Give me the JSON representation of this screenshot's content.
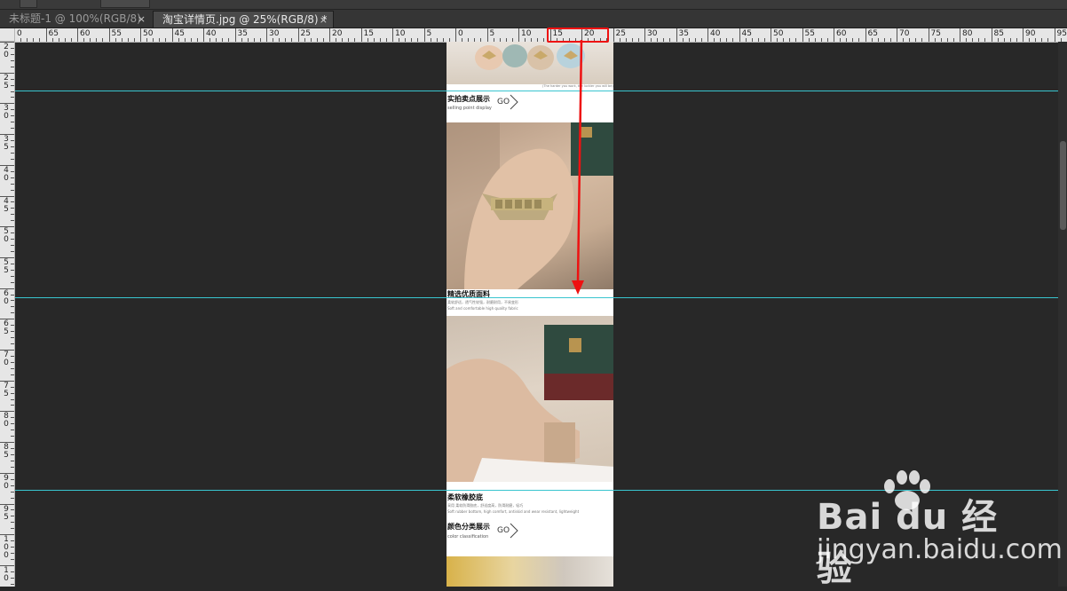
{
  "tabs": [
    {
      "label": "未标题-1 @ 100%(RGB/8)",
      "close": "×",
      "active": false
    },
    {
      "label": "淘宝详情页.jpg @ 25%(RGB/8) *",
      "close": "×",
      "active": true
    }
  ],
  "ruler": {
    "h_labels": [
      "0",
      "65",
      "60",
      "55",
      "50",
      "45",
      "40",
      "35",
      "30",
      "25",
      "20",
      "15",
      "10",
      "5",
      "0",
      "5",
      "10",
      "15",
      "20",
      "25",
      "30",
      "35",
      "40",
      "45",
      "50",
      "55",
      "60",
      "65",
      "70",
      "75",
      "80",
      "85",
      "90",
      "95"
    ],
    "v_labels": [
      "2\n0",
      "2\n5",
      "3\n0",
      "3\n5",
      "4\n0",
      "4\n5",
      "5\n0",
      "5\n5",
      "6\n0",
      "6\n5",
      "7\n0",
      "7\n5",
      "8\n0",
      "8\n5",
      "9\n0",
      "9\n5",
      "1\n0\n0",
      "1\n0"
    ]
  },
  "document": {
    "banner_tiny": "(The harder you work, the luckier you will be)",
    "section1_title": "实拍卖点展示",
    "section1_sub": "selling point display",
    "go": "GO",
    "section2_title": "精选优质面料",
    "section2_sub": "柔软舒适，透气性较强，耐磨耐用，不易变形",
    "section2_sub_en": "Soft and comfortable high quality fabric",
    "section3_title": "柔软橡胶底",
    "section3_sub": "采用 柔软防滑胶底，舒适度高，防滑耐磨，轻巧",
    "section3_sub_en": "Soft rubber bottom, high comfort, antiskid and wear resistant, lightweight",
    "section4_title": "颜色分类展示",
    "section4_sub": "color classification"
  },
  "watermark": {
    "logo": "Bai du 经验",
    "url": "jingyan.baidu.com"
  },
  "colors": {
    "guide": "#39c5cf",
    "highlight": "#ee1111",
    "canvas": "#282828"
  }
}
